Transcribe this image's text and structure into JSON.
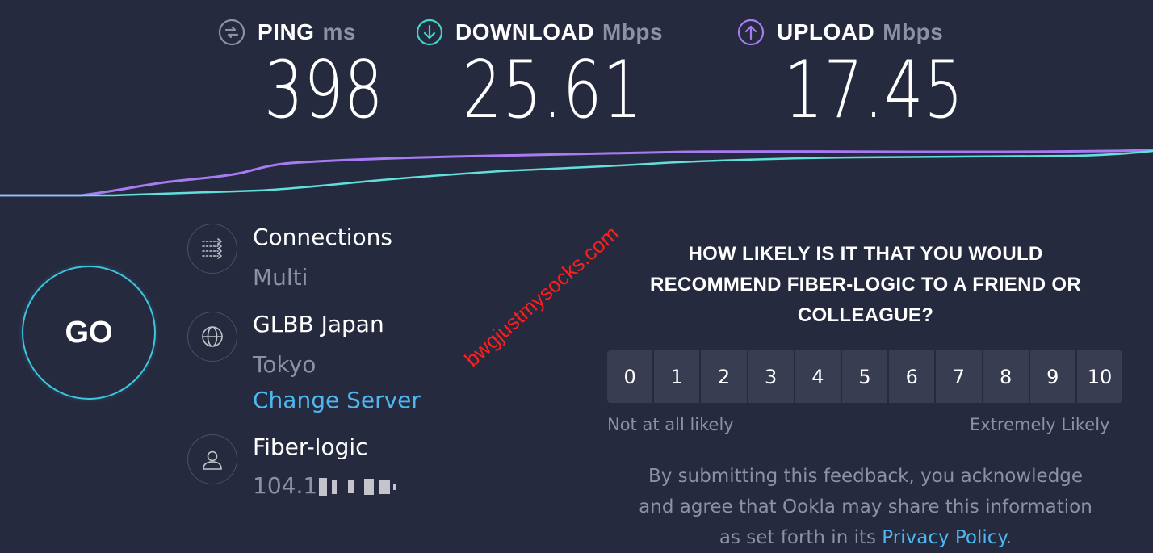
{
  "metrics": {
    "ping": {
      "label": "PING",
      "unit": "ms",
      "value": "398",
      "color": "#8e90a3"
    },
    "download": {
      "label": "DOWNLOAD",
      "unit": "Mbps",
      "value": "25.61",
      "color": "#3fd6c8"
    },
    "upload": {
      "label": "UPLOAD",
      "unit": "Mbps",
      "value": "17.45",
      "color": "#a77bf2"
    }
  },
  "go_button": {
    "label": "GO"
  },
  "connections": {
    "title": "Connections",
    "value": "Multi",
    "icon": "connections-icon"
  },
  "server": {
    "name": "GLBB Japan",
    "location": "Tokyo",
    "change_link": "Change Server",
    "icon": "globe-icon"
  },
  "provider": {
    "name": "Fiber-logic",
    "ip": "104.1",
    "icon": "user-icon"
  },
  "watermark": "bwgjustmysocks.com",
  "survey": {
    "question_line1": "HOW LIKELY IS IT THAT YOU WOULD",
    "question_line2": "RECOMMEND FIBER-LOGIC TO A FRIEND OR",
    "question_line3": "COLLEAGUE?",
    "options": [
      "0",
      "1",
      "2",
      "3",
      "4",
      "5",
      "6",
      "7",
      "8",
      "9",
      "10"
    ],
    "low_label": "Not at all likely",
    "high_label": "Extremely Likely",
    "disclaimer_line1": "By submitting this feedback, you acknowledge",
    "disclaimer_line2": "and agree that Ookla may share this information",
    "disclaimer_line3": "as set forth in its",
    "privacy_link": "Privacy Policy",
    "period": "."
  }
}
